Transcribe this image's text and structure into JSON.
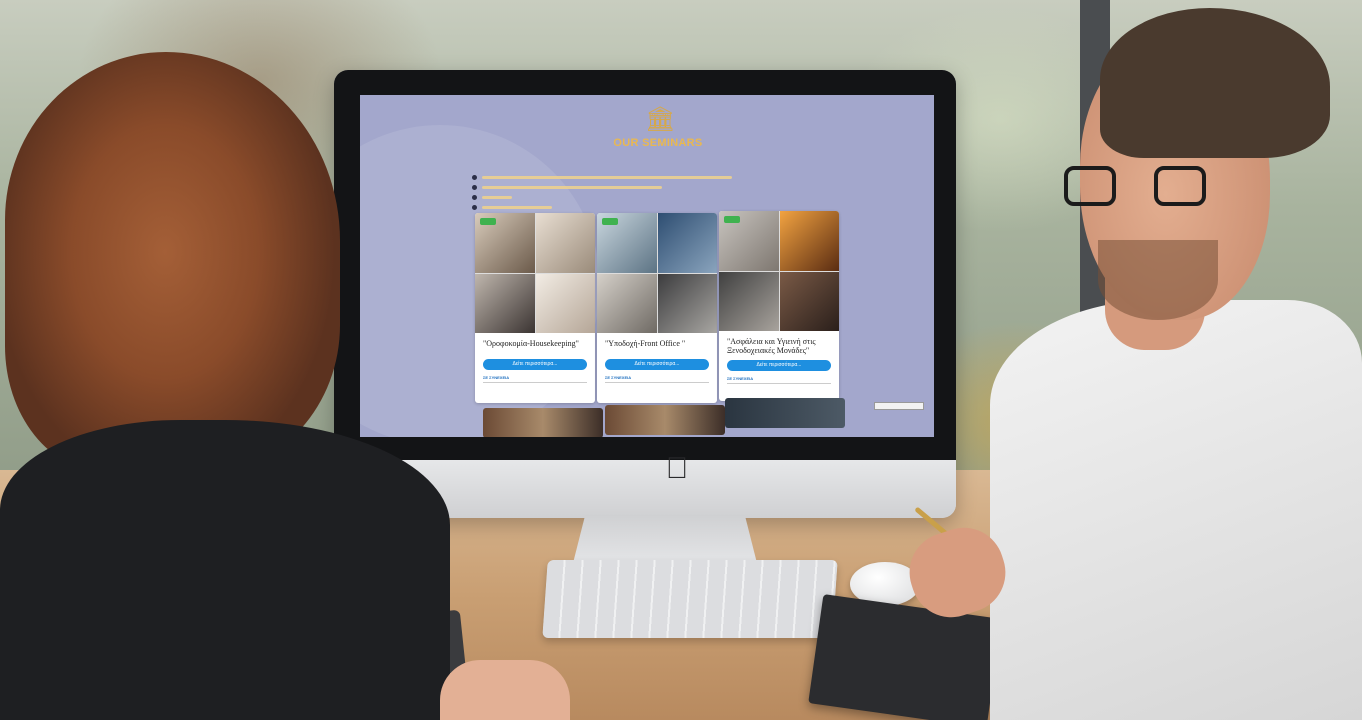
{
  "scene": {
    "description_elements": [
      "woman",
      "man",
      "desktop-monitor",
      "keyboard",
      "mouse",
      "notebook"
    ]
  },
  "screen": {
    "section_title": "OUR SEMINARS",
    "section_icon": "building-columns-icon",
    "accent_color": "#e9b851",
    "background_color": "#a3a7cc",
    "cards": [
      {
        "title": "\"Ορoφοκομία-Housekeeping\"",
        "button_label": "Δείτε περισσότερα...",
        "link_label": "ΣΕ ΣΥΝΕΧΕΙΑ"
      },
      {
        "title": "\"Υποδοχή-Front Office \"",
        "button_label": "Δείτε περισσότερα...",
        "link_label": "ΣΕ ΣΥΝΕΧΕΙΑ"
      },
      {
        "title": "\"Ασφάλεια και Υγιεινή στις Ξενοδοχειακές Μονάδες\"",
        "button_label": "Δείτε περισσότερα...",
        "link_label": "ΣΕ ΣΥΝΕΧΕΙΑ"
      }
    ],
    "button_color": "#1e8fe0",
    "badge_color": "#3fb24f"
  }
}
